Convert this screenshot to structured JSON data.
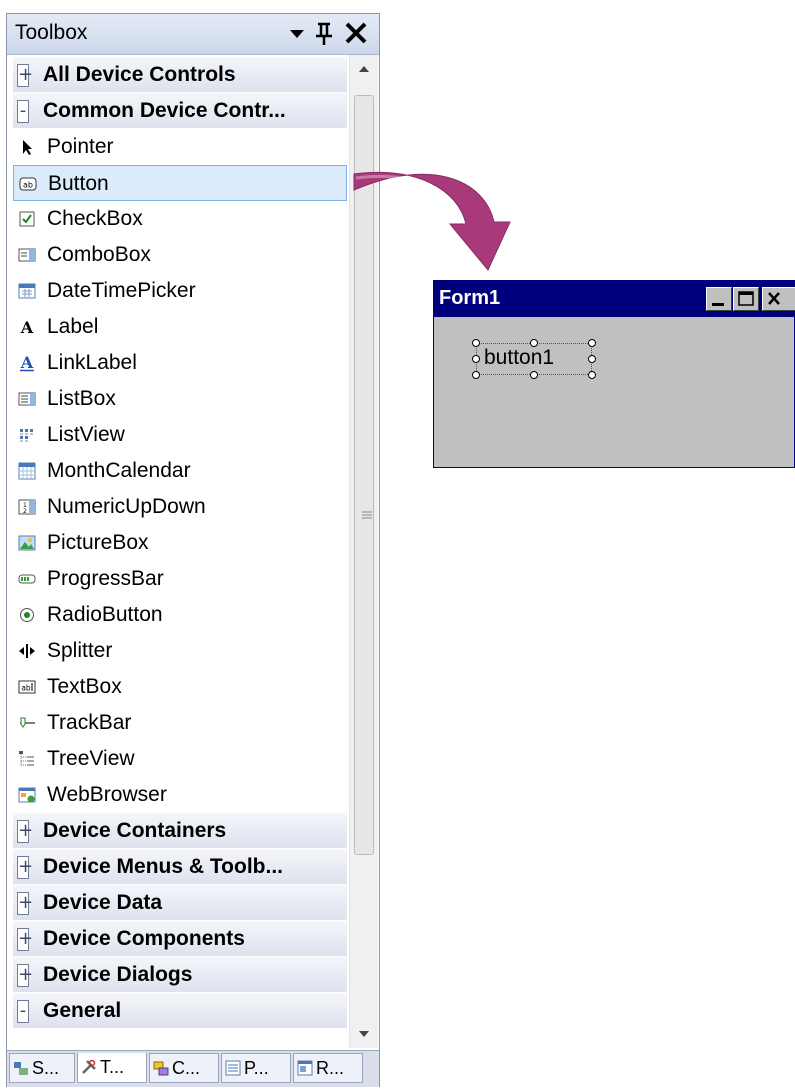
{
  "toolbox": {
    "title": "Toolbox",
    "controls": {
      "dropdown": "▾",
      "pin": "ᵖ",
      "close": "✕"
    },
    "categories_top": [
      {
        "label": "All Device Controls",
        "expanded": false
      },
      {
        "label": "Common Device Contr...",
        "expanded": true
      }
    ],
    "items": [
      {
        "label": "Pointer",
        "icon": "pointer-icon"
      },
      {
        "label": "Button",
        "icon": "button-icon",
        "selected": true
      },
      {
        "label": "CheckBox",
        "icon": "checkbox-icon"
      },
      {
        "label": "ComboBox",
        "icon": "combobox-icon"
      },
      {
        "label": "DateTimePicker",
        "icon": "datetimepicker-icon"
      },
      {
        "label": "Label",
        "icon": "label-icon"
      },
      {
        "label": "LinkLabel",
        "icon": "linklabel-icon"
      },
      {
        "label": "ListBox",
        "icon": "listbox-icon"
      },
      {
        "label": "ListView",
        "icon": "listview-icon"
      },
      {
        "label": "MonthCalendar",
        "icon": "monthcalendar-icon"
      },
      {
        "label": "NumericUpDown",
        "icon": "numericupdown-icon"
      },
      {
        "label": "PictureBox",
        "icon": "picturebox-icon"
      },
      {
        "label": "ProgressBar",
        "icon": "progressbar-icon"
      },
      {
        "label": "RadioButton",
        "icon": "radiobutton-icon"
      },
      {
        "label": "Splitter",
        "icon": "splitter-icon"
      },
      {
        "label": "TextBox",
        "icon": "textbox-icon"
      },
      {
        "label": "TrackBar",
        "icon": "trackbar-icon"
      },
      {
        "label": "TreeView",
        "icon": "treeview-icon"
      },
      {
        "label": "WebBrowser",
        "icon": "webbrowser-icon"
      }
    ],
    "categories_bottom": [
      {
        "label": "Device Containers",
        "expanded": false
      },
      {
        "label": "Device Menus & Toolb...",
        "expanded": false
      },
      {
        "label": "Device Data",
        "expanded": false
      },
      {
        "label": "Device Components",
        "expanded": false
      },
      {
        "label": "Device Dialogs",
        "expanded": false
      },
      {
        "label": "General",
        "expanded": true
      }
    ],
    "tabs": [
      {
        "label": "S...",
        "icon": "solution-explorer-icon"
      },
      {
        "label": "T...",
        "icon": "toolbox-icon",
        "active": true
      },
      {
        "label": "C...",
        "icon": "class-view-icon"
      },
      {
        "label": "P...",
        "icon": "properties-icon"
      },
      {
        "label": "R...",
        "icon": "resource-view-icon"
      }
    ]
  },
  "form": {
    "title": "Form1",
    "button_text": "button1"
  },
  "colors": {
    "form_titlebar": "#00007d",
    "form_background": "#c0c0c0",
    "arrow": "#a83a7a",
    "selection": "#dcebfc"
  }
}
